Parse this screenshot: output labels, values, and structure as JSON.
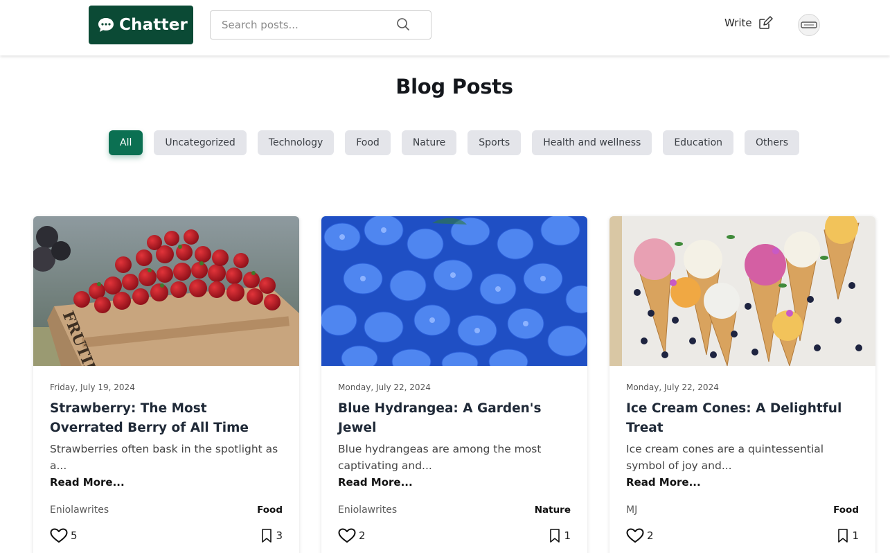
{
  "header": {
    "logo_text": "Chatter",
    "search_placeholder": "Search posts...",
    "write_label": "Write"
  },
  "page": {
    "title": "Blog Posts"
  },
  "filters": [
    {
      "label": "All",
      "active": true
    },
    {
      "label": "Uncategorized",
      "active": false
    },
    {
      "label": "Technology",
      "active": false
    },
    {
      "label": "Food",
      "active": false
    },
    {
      "label": "Nature",
      "active": false
    },
    {
      "label": "Sports",
      "active": false
    },
    {
      "label": "Health and wellness",
      "active": false
    },
    {
      "label": "Education",
      "active": false
    },
    {
      "label": "Others",
      "active": false
    }
  ],
  "posts": [
    {
      "date": "Friday, July 19, 2024",
      "title": "Strawberry: The Most Overrated Berry of All Time",
      "excerpt": "Strawberries often bask in the spotlight as a...",
      "read_more": "Read More...",
      "author": "Eniolawrites",
      "category": "Food",
      "likes": "5",
      "bookmarks": "3",
      "image": "strawberries-photo"
    },
    {
      "date": "Monday, July 22, 2024",
      "title": "Blue Hydrangea: A Garden's Jewel",
      "excerpt": "Blue hydrangeas are among the most captivating and...",
      "read_more": "Read More...",
      "author": "Eniolawrites",
      "category": "Nature",
      "likes": "2",
      "bookmarks": "1",
      "image": "blue-hydrangea-photo"
    },
    {
      "date": "Monday, July 22, 2024",
      "title": "Ice Cream Cones: A Delightful Treat",
      "excerpt": "Ice cream cones are a quintessential symbol of joy and...",
      "read_more": "Read More...",
      "author": "MJ",
      "category": "Food",
      "likes": "2",
      "bookmarks": "1",
      "image": "ice-cream-cones-photo"
    }
  ],
  "colors": {
    "brand": "#0b4a35",
    "accent": "#0b7052",
    "chip_bg": "#e4e5ea"
  }
}
